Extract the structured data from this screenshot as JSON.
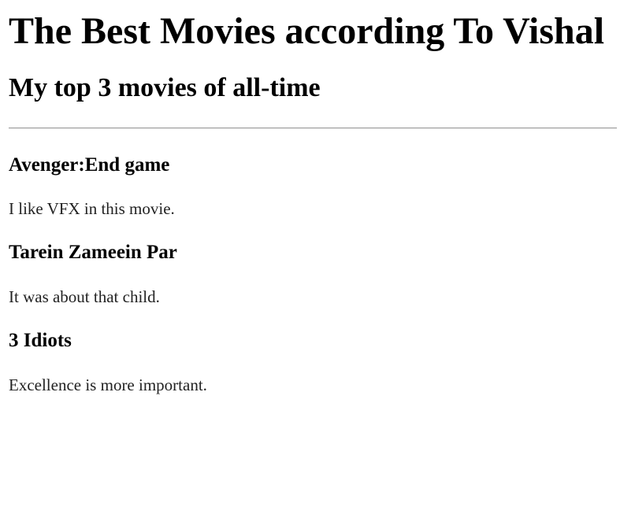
{
  "page": {
    "title": "The Best Movies according To Vishal",
    "subtitle": "My top 3 movies of all-time"
  },
  "movies": [
    {
      "title": "Avenger:End game",
      "description": "I like VFX in this movie."
    },
    {
      "title": "Tarein Zameein Par",
      "description": "It was about that child."
    },
    {
      "title": "3 Idiots",
      "description": "Excellence is more important."
    }
  ]
}
